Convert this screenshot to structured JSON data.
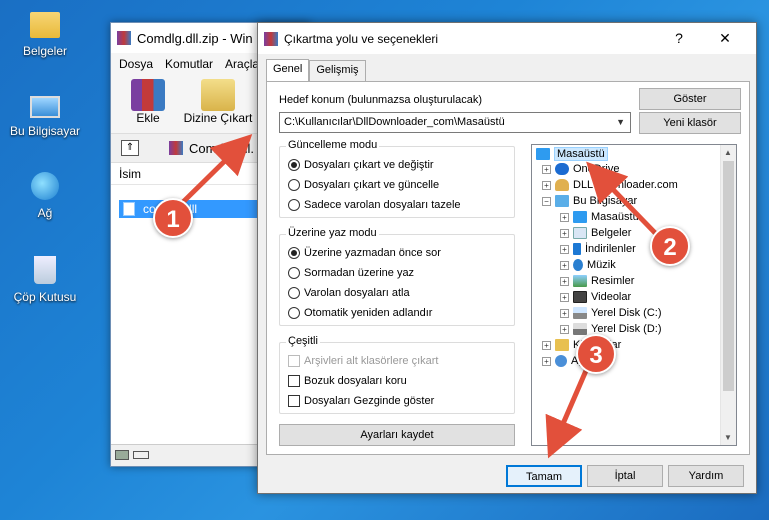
{
  "desktop": {
    "icons": [
      {
        "label": "Belgeler"
      },
      {
        "label": "Bu Bilgisayar"
      },
      {
        "label": "Ağ"
      },
      {
        "label": "Çöp Kutusu"
      }
    ]
  },
  "winrar": {
    "title": "Comdlg.dll.zip - Win",
    "menu": [
      "Dosya",
      "Komutlar",
      "Araçla"
    ],
    "tools": {
      "add": "Ekle",
      "extract": "Dizine Çıkart"
    },
    "address": "Comdlg.dll.",
    "list_header": "İsim",
    "row_name": "comdlg.dll"
  },
  "dialog": {
    "title": "Çıkartma yolu ve seçenekleri",
    "title_buttons": {
      "help": "?",
      "close": "✕"
    },
    "tabs": [
      "Genel",
      "Gelişmiş"
    ],
    "dest_label": "Hedef konum (bulunmazsa oluşturulacak)",
    "dest_value": "C:\\Kullanıcılar\\DllDownloader_com\\Masaüstü",
    "show_button": "Göster",
    "new_folder_button": "Yeni klasör",
    "update_mode": {
      "title": "Güncelleme modu",
      "options": [
        "Dosyaları çıkart ve değiştir",
        "Dosyaları çıkart ve güncelle",
        "Sadece varolan dosyaları tazele"
      ],
      "selected": 0
    },
    "overwrite_mode": {
      "title": "Üzerine yaz modu",
      "options": [
        "Üzerine yazmadan önce sor",
        "Sormadan üzerine yaz",
        "Varolan dosyaları atla",
        "Otomatik yeniden adlandır"
      ],
      "selected": 0
    },
    "misc": {
      "title": "Çeşitli",
      "options": [
        {
          "label": "Arşivleri alt klasörlere çıkart",
          "checked": false,
          "disabled": true
        },
        {
          "label": "Bozuk dosyaları koru",
          "checked": false,
          "disabled": false
        },
        {
          "label": "Dosyaları Gezginde göster",
          "checked": false,
          "disabled": false
        }
      ]
    },
    "save_button": "Ayarları kaydet",
    "tree": [
      {
        "label": "Masaüstü",
        "icon": "desktop-icon",
        "selected": true
      },
      {
        "label": "OneDrive",
        "icon": "cloud-icon"
      },
      {
        "label": "DLL Downloader.com",
        "icon": "user-icon"
      },
      {
        "label": "Bu Bilgisayar",
        "icon": "computer-icon"
      },
      {
        "label": "Masaüstü",
        "icon": "desktop-icon"
      },
      {
        "label": "Belgeler",
        "icon": "documents-icon"
      },
      {
        "label": "İndirilenler",
        "icon": "download-icon"
      },
      {
        "label": "Müzik",
        "icon": "music-icon"
      },
      {
        "label": "Resimler",
        "icon": "pictures-icon"
      },
      {
        "label": "Videolar",
        "icon": "videos-icon"
      },
      {
        "label": "Yerel Disk (C:)",
        "icon": "drive-icon"
      },
      {
        "label": "Yerel Disk (D:)",
        "icon": "drive-icon"
      },
      {
        "label": "Kitaplıklar",
        "icon": "library-icon"
      },
      {
        "label": "Ağ",
        "icon": "network-icon"
      }
    ],
    "ok": "Tamam",
    "cancel": "İptal",
    "help": "Yardım"
  },
  "markers": [
    "1",
    "2",
    "3"
  ],
  "colors": {
    "accent": "#0078d7",
    "selection": "#3399ff",
    "marker": "#e2503b"
  }
}
